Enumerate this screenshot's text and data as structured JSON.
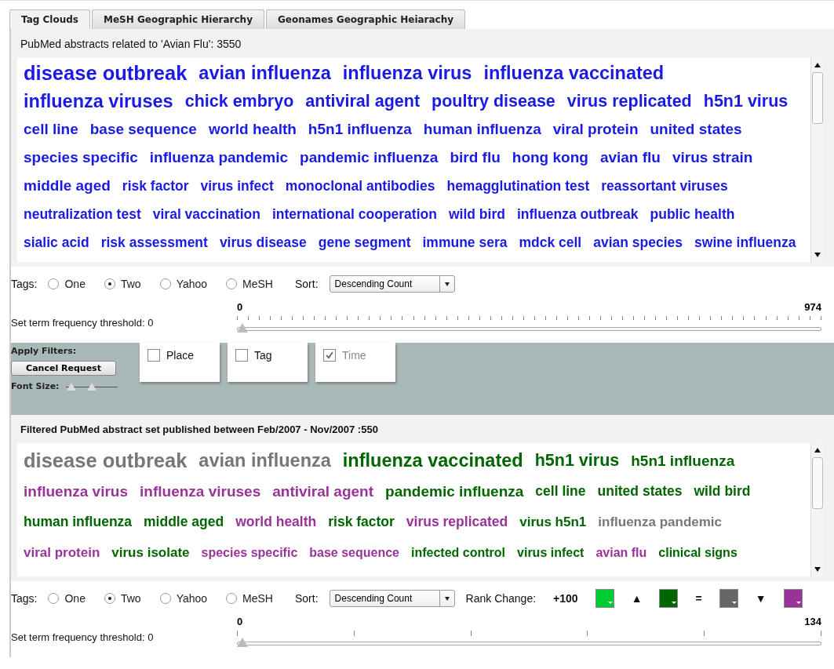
{
  "tabs": [
    {
      "label": "Tag Clouds",
      "selected": true
    },
    {
      "label": "MeSH Geographic Hierarchy",
      "selected": false
    },
    {
      "label": "Geonames Geographic Heiarachy",
      "selected": false
    }
  ],
  "top": {
    "heading": "PubMed abstracts related to 'Avian Flu': 3550",
    "tags": [
      {
        "text": "disease outbreak",
        "kind": "largest"
      },
      {
        "text": "avian influenza",
        "kind": "larger"
      },
      {
        "text": "influenza virus",
        "kind": "larger"
      },
      {
        "text": "influenza vaccinated",
        "kind": "larger"
      },
      {
        "text": "influenza viruses",
        "kind": "larger"
      },
      {
        "text": "chick embryo",
        "kind": "large"
      },
      {
        "text": "antiviral agent",
        "kind": "large"
      },
      {
        "text": "poultry disease",
        "kind": "large"
      },
      {
        "text": "virus replicated",
        "kind": "large"
      },
      {
        "text": "h5n1 virus",
        "kind": "large"
      },
      {
        "text": "cell line",
        "kind": "medium"
      },
      {
        "text": "base sequence",
        "kind": "medium"
      },
      {
        "text": "world health",
        "kind": "medium"
      },
      {
        "text": "h5n1 influenza",
        "kind": "medium"
      },
      {
        "text": "human influenza",
        "kind": "medium"
      },
      {
        "text": "viral protein",
        "kind": "medium"
      },
      {
        "text": "united states",
        "kind": "medium"
      },
      {
        "text": "species specific",
        "kind": "medium"
      },
      {
        "text": "influenza pandemic",
        "kind": "medium"
      },
      {
        "text": "pandemic influenza",
        "kind": "medium"
      },
      {
        "text": "bird flu",
        "kind": "medium"
      },
      {
        "text": "hong kong",
        "kind": "medium"
      },
      {
        "text": "avian flu",
        "kind": "medium"
      },
      {
        "text": "virus strain",
        "kind": "medium"
      },
      {
        "text": "middle aged",
        "kind": "medium"
      },
      {
        "text": "risk factor",
        "kind": "small"
      },
      {
        "text": "virus infect",
        "kind": "small"
      },
      {
        "text": "monoclonal antibodies",
        "kind": "small"
      },
      {
        "text": "hemagglutination test",
        "kind": "small"
      },
      {
        "text": "reassortant viruses",
        "kind": "small"
      },
      {
        "text": "neutralization test",
        "kind": "small"
      },
      {
        "text": "viral vaccination",
        "kind": "small"
      },
      {
        "text": "international cooperation",
        "kind": "small"
      },
      {
        "text": "wild bird",
        "kind": "small"
      },
      {
        "text": "influenza outbreak",
        "kind": "small"
      },
      {
        "text": "public health",
        "kind": "small"
      },
      {
        "text": "sialic acid",
        "kind": "small"
      },
      {
        "text": "risk assessment",
        "kind": "small"
      },
      {
        "text": "virus disease",
        "kind": "small"
      },
      {
        "text": "gene segment",
        "kind": "small"
      },
      {
        "text": "immune sera",
        "kind": "small"
      },
      {
        "text": "mdck cell",
        "kind": "small"
      },
      {
        "text": "avian species",
        "kind": "small"
      },
      {
        "text": "swine influenza",
        "kind": "small"
      }
    ],
    "tags_label": "Tags:",
    "tag_options": [
      {
        "label": "One",
        "selected": false
      },
      {
        "label": "Two",
        "selected": true
      },
      {
        "label": "Yahoo",
        "selected": false
      },
      {
        "label": "MeSH",
        "selected": false
      }
    ],
    "sort_label": "Sort:",
    "sort_value": "Descending Count",
    "threshold_label": "Set term frequency threshold: 0",
    "slider_min": "0",
    "slider_max": "974",
    "level": 0
  },
  "filters": {
    "label": "Apply Filters:",
    "cancel_button": "Cancel Request",
    "font_size_label": "Font Size:",
    "font_size_thumbs": [
      {
        "level": 0.12
      },
      {
        "level": 0.5
      }
    ],
    "checks": [
      {
        "label": "Place",
        "checked": false,
        "disabled": false
      },
      {
        "label": "Tag",
        "checked": false,
        "disabled": false
      },
      {
        "label": "Time",
        "checked": true,
        "disabled": true
      }
    ]
  },
  "bottom": {
    "heading": "Filtered PubMed abstract set published between Feb/2007 - Nov/2007 :550",
    "tags": [
      {
        "text": "disease outbreak",
        "kind": "largest",
        "color": "#777777"
      },
      {
        "text": "avian influenza",
        "kind": "larger",
        "color": "#777777"
      },
      {
        "text": "influenza vaccinated",
        "kind": "larger",
        "color": "#006600"
      },
      {
        "text": "h5n1 virus",
        "kind": "large",
        "color": "#006600"
      },
      {
        "text": "h5n1 influenza",
        "kind": "medium",
        "color": "#006600"
      },
      {
        "text": "influenza virus",
        "kind": "medium",
        "color": "#993399"
      },
      {
        "text": "influenza viruses",
        "kind": "medium",
        "color": "#993399"
      },
      {
        "text": "antiviral agent",
        "kind": "medium",
        "color": "#993399"
      },
      {
        "text": "pandemic influenza",
        "kind": "medium",
        "color": "#006600"
      },
      {
        "text": "cell line",
        "kind": "small",
        "color": "#006600"
      },
      {
        "text": "united states",
        "kind": "small",
        "color": "#006600"
      },
      {
        "text": "wild bird",
        "kind": "small",
        "color": "#006600"
      },
      {
        "text": "human influenza",
        "kind": "small",
        "color": "#006600"
      },
      {
        "text": "middle aged",
        "kind": "small",
        "color": "#006600"
      },
      {
        "text": "world health",
        "kind": "small",
        "color": "#993399"
      },
      {
        "text": "risk factor",
        "kind": "small",
        "color": "#006600"
      },
      {
        "text": "virus replicated",
        "kind": "small",
        "color": "#993399"
      },
      {
        "text": "virus h5n1",
        "kind": "smaller",
        "color": "#006600"
      },
      {
        "text": "influenza pandemic",
        "kind": "smaller",
        "color": "#777777"
      },
      {
        "text": "viral protein",
        "kind": "smaller",
        "color": "#993399"
      },
      {
        "text": "virus isolate",
        "kind": "smaller",
        "color": "#006600"
      },
      {
        "text": "species specific",
        "kind": "smallest",
        "color": "#993399"
      },
      {
        "text": "base sequence",
        "kind": "smallest",
        "color": "#993399"
      },
      {
        "text": "infected control",
        "kind": "smallest",
        "color": "#006600"
      },
      {
        "text": "virus infect",
        "kind": "smallest",
        "color": "#006600"
      },
      {
        "text": "avian flu",
        "kind": "smallest",
        "color": "#993399"
      },
      {
        "text": "clinical signs",
        "kind": "smallest",
        "color": "#006600"
      }
    ],
    "tags_label": "Tags:",
    "tag_options": [
      {
        "label": "One",
        "selected": false
      },
      {
        "label": "Two",
        "selected": true
      },
      {
        "label": "Yahoo",
        "selected": false
      },
      {
        "label": "MeSH",
        "selected": false
      }
    ],
    "sort_label": "Sort:",
    "sort_value": "Descending Count",
    "rank_label": "Rank Change:",
    "legend": [
      {
        "kind": "text",
        "text": "+100"
      },
      {
        "kind": "swatch",
        "color": "#00cc33"
      },
      {
        "kind": "text",
        "text": "▲"
      },
      {
        "kind": "swatch",
        "color": "#006600"
      },
      {
        "kind": "text",
        "text": "="
      },
      {
        "kind": "swatch",
        "color": "#666666"
      },
      {
        "kind": "text",
        "text": "▼"
      },
      {
        "kind": "swatch",
        "color": "#993399"
      }
    ],
    "threshold_label": "Set term frequency threshold: 0",
    "slider_min": "0",
    "slider_max": "134",
    "level": 0
  }
}
